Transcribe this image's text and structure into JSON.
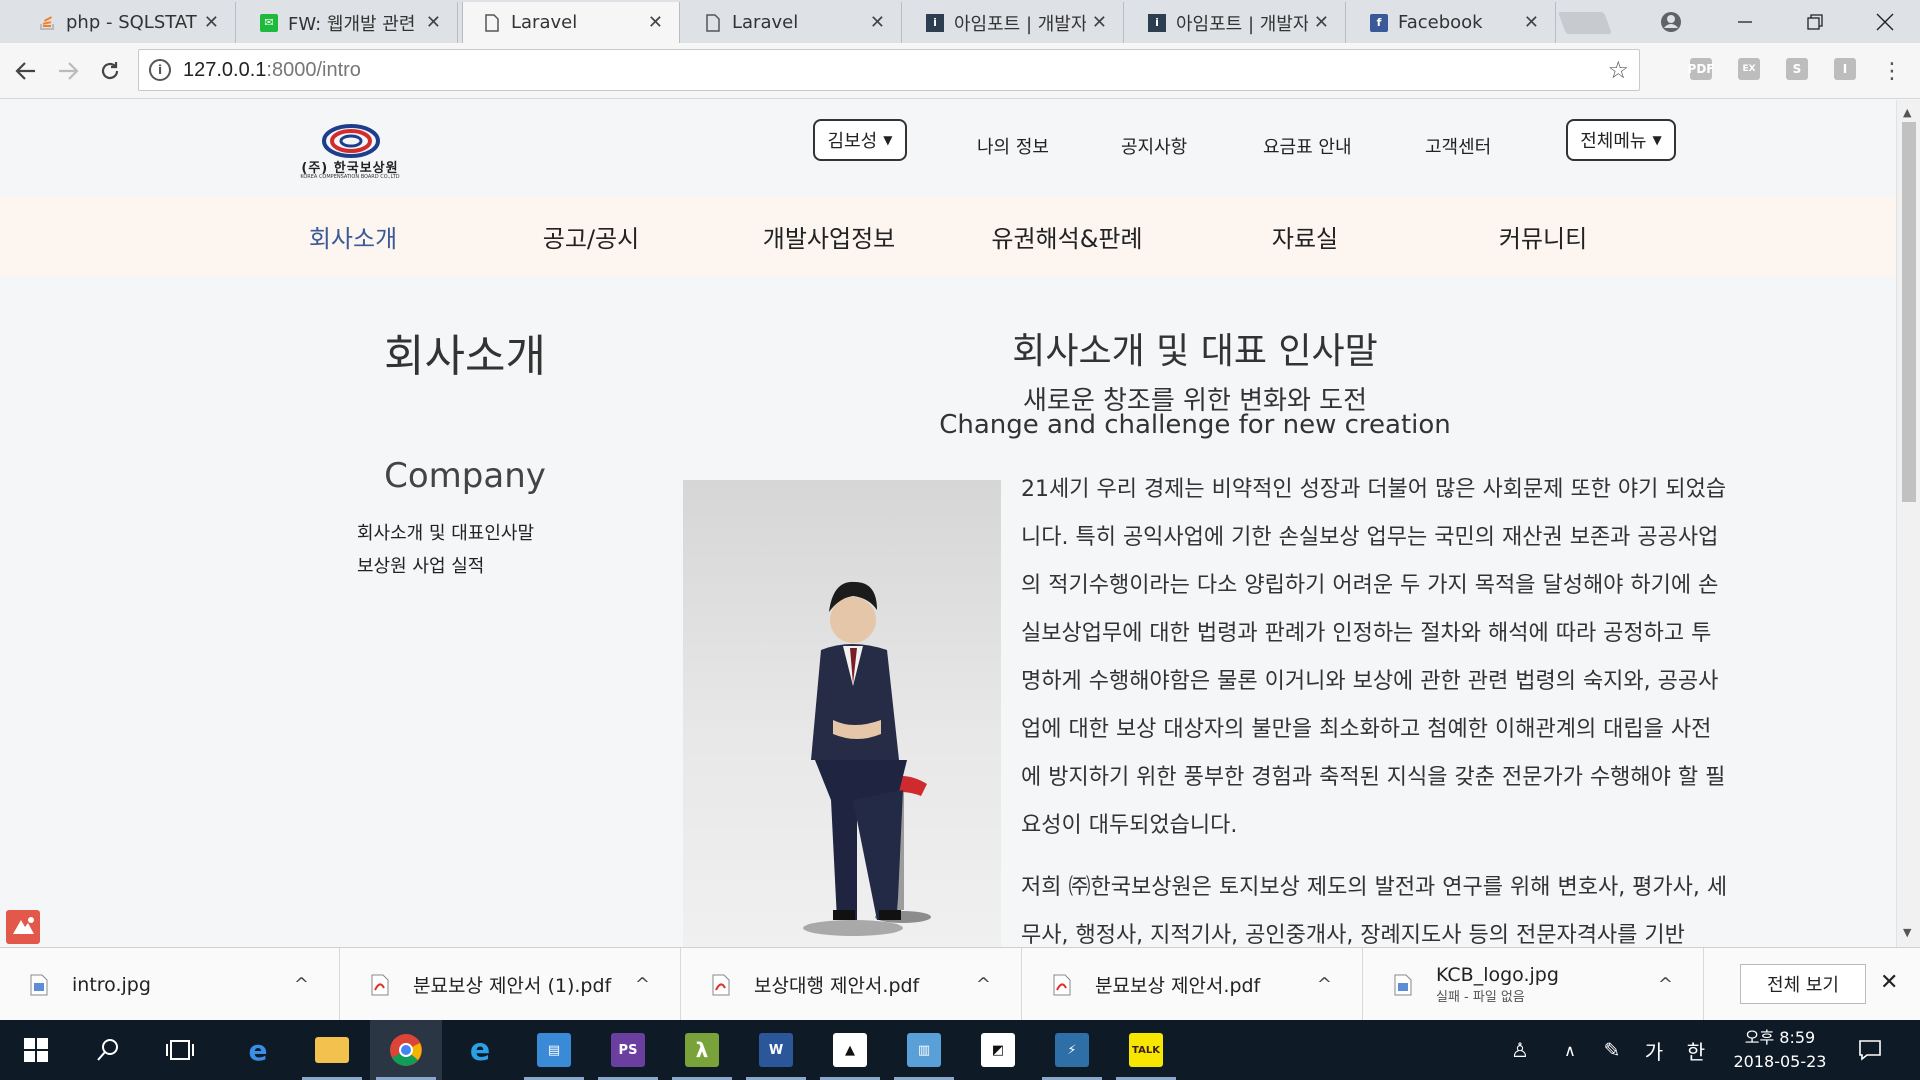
{
  "browser": {
    "tabs": [
      {
        "title": "php - SQLSTATE",
        "favicon": "stackoverflow-icon",
        "color": "#f48024"
      },
      {
        "title": "FW: 웹개발 관련",
        "favicon": "mail-icon",
        "color": "#1fba3b"
      },
      {
        "title": "Laravel",
        "favicon": "page-icon",
        "color": "#555555",
        "active": true
      },
      {
        "title": "Laravel",
        "favicon": "page-icon",
        "color": "#555555"
      },
      {
        "title": "아임포트 | 개발자",
        "favicon": "iamport-icon",
        "color": "#2c3e50"
      },
      {
        "title": "아임포트 | 개발자",
        "favicon": "iamport-icon",
        "color": "#2c3e50"
      },
      {
        "title": "Facebook",
        "favicon": "facebook-icon",
        "color": "#3b5998"
      }
    ],
    "close_glyph": "✕",
    "url_host": "127.0.0.1",
    "url_path": ":8000/intro",
    "extensions": [
      "PDF",
      "EX",
      "S",
      "I"
    ]
  },
  "site": {
    "logo_name": "(주) 한국보상원",
    "logo_eng": "KOREA COMPENSATION BOARD CO.,LTD",
    "user_menu": "김보성",
    "top_links": [
      "나의 정보",
      "공지사항",
      "요금표 안내",
      "고객센터"
    ],
    "all_menu": "전체메뉴",
    "main_nav": [
      "회사소개",
      "공고/공시",
      "개발사업정보",
      "유권해석&판례",
      "자료실",
      "커뮤니티"
    ],
    "sidebar": {
      "title": "회사소개",
      "subtitle": "Company",
      "links": [
        "회사소개 및 대표인사말",
        "보상원 사업 실적"
      ]
    },
    "content": {
      "title": "회사소개 및 대표 인사말",
      "subtitle_ko": "새로운 창조를 위한 변화와 도전",
      "subtitle_en": "Change and challenge for new creation",
      "paragraph1": "21세기 우리 경제는 비약적인 성장과 더불어 많은 사회문제 또한 야기 되었습니다. 특히 공익사업에 기한 손실보상 업무는 국민의 재산권 보존과 공공사업의 적기수행이라는 다소 양립하기 어려운 두 가지 목적을 달성해야 하기에 손실보상업무에 대한 법령과 판례가 인정하는 절차와 해석에 따라 공정하고 투명하게 수행해야함은 물론 이거니와 보상에 관한 관련 법령의 숙지와, 공공사업에 대한 보상 대상자의 불만을 최소화하고 첨예한 이해관계의 대립을 사전에 방지하기 위한 풍부한 경험과 축적된 지식을 갖춘 전문가가 수행해야 할 필요성이 대두되었습니다.",
      "paragraph2": "저희 ㈜한국보상원은 토지보상 제도의 발전과 연구를 위해 변호사, 평가사, 세무사, 행정사, 지적기사, 공인중개사, 장례지도사 등의 전문자격사를 기반"
    }
  },
  "downloads": {
    "items": [
      {
        "name": "intro.jpg",
        "status": "",
        "icon": "image-file-icon"
      },
      {
        "name": "분묘보상 제안서 (1).pdf",
        "status": "",
        "icon": "pdf-file-icon"
      },
      {
        "name": "보상대행 제안서.pdf",
        "status": "",
        "icon": "pdf-file-icon"
      },
      {
        "name": "분묘보상 제안서.pdf",
        "status": "",
        "icon": "pdf-file-icon"
      },
      {
        "name": "KCB_logo.jpg",
        "status": "실패 - 파일 없음",
        "icon": "image-file-icon"
      }
    ],
    "show_all": "전체 보기"
  },
  "taskbar": {
    "ime_mode": "가",
    "ime_lang": "한",
    "clock_period_time": "오후 8:59",
    "clock_date": "2018-05-23"
  },
  "colors": {
    "main_nav_active": "#3c5a96",
    "main_nav_bg": "#fcf5f0",
    "page_bg": "#f4f6f8",
    "taskbar_bg": "#0f1a27"
  }
}
